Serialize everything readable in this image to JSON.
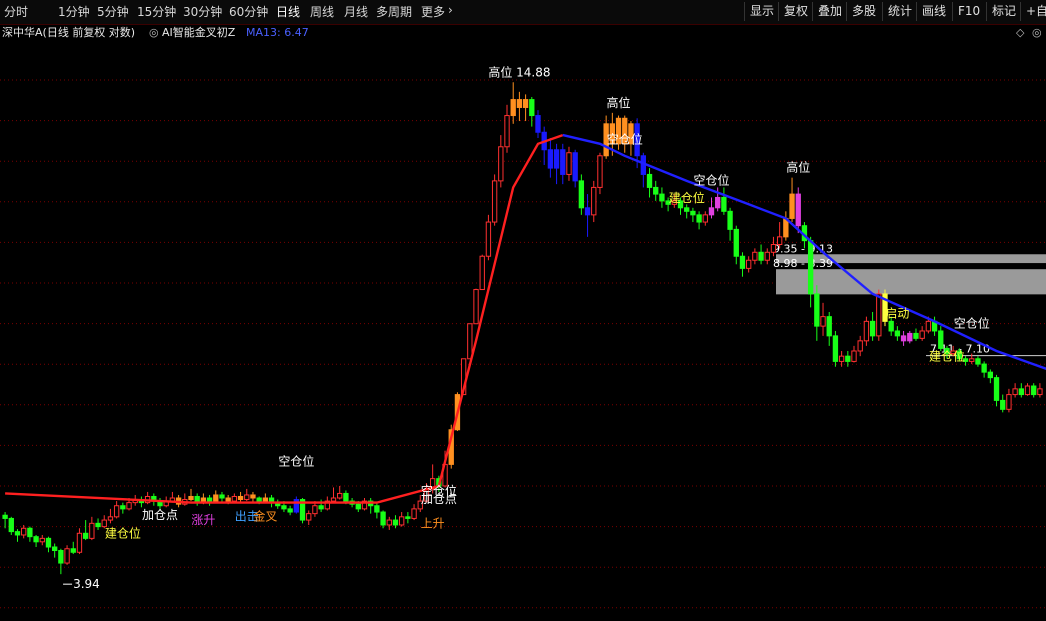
{
  "toolbar": {
    "timeframes": [
      "分时",
      "1分钟",
      "5分钟",
      "15分钟",
      "30分钟",
      "60分钟",
      "日线",
      "周线",
      "月线",
      "多周期",
      "更多"
    ],
    "active": "日线",
    "right_buttons": [
      "显示",
      "复权",
      "叠加",
      "多股",
      "统计",
      "画线",
      "F10",
      "标记",
      "+自选"
    ]
  },
  "info": {
    "stock_desc": "深中华A(日线 前复权 对数)",
    "indicator": "AI智能金叉初Z",
    "ma": "MA13: 6.47"
  },
  "colors": {
    "up": "#ff3030",
    "down": "#18ff18",
    "hot": "#ff9020",
    "cool": "#1a1aff",
    "magenta": "#e040e0",
    "yellow": "#ffff40",
    "ma_red": "#ff2020",
    "ma_blue": "#2020ff",
    "grid": "#7a0000"
  },
  "chart_data": {
    "type": "candlestick",
    "y_range": [
      3.5,
      16.5
    ],
    "candles": [
      [
        4.62,
        4.58,
        4.66,
        4.46
      ],
      [
        4.58,
        4.42,
        4.6,
        4.38
      ],
      [
        4.42,
        4.38,
        4.45,
        4.3
      ],
      [
        4.38,
        4.46,
        4.5,
        4.34
      ],
      [
        4.46,
        4.36,
        4.48,
        4.3
      ],
      [
        4.36,
        4.3,
        4.38,
        4.24
      ],
      [
        4.3,
        4.34,
        4.38,
        4.26
      ],
      [
        4.34,
        4.24,
        4.36,
        4.18
      ],
      [
        4.24,
        4.2,
        4.28,
        4.12
      ],
      [
        4.2,
        4.06,
        4.22,
        3.94
      ],
      [
        4.06,
        4.22,
        4.26,
        4.04
      ],
      [
        4.22,
        4.18,
        4.3,
        4.16
      ],
      [
        4.18,
        4.4,
        4.46,
        4.16
      ],
      [
        4.4,
        4.34,
        4.56,
        4.32
      ],
      [
        4.34,
        4.52,
        4.6,
        4.32
      ],
      [
        4.52,
        4.48,
        4.58,
        4.44
      ],
      [
        4.48,
        4.56,
        4.62,
        4.46
      ],
      [
        4.56,
        4.6,
        4.7,
        4.52
      ],
      [
        4.6,
        4.74,
        4.8,
        4.58
      ],
      [
        4.74,
        4.7,
        4.78,
        4.64
      ],
      [
        4.7,
        4.78,
        4.84,
        4.68
      ],
      [
        4.78,
        4.82,
        4.88,
        4.74
      ],
      [
        4.82,
        4.78,
        4.86,
        4.72
      ],
      [
        4.78,
        4.86,
        4.92,
        4.76
      ],
      [
        4.86,
        4.8,
        4.9,
        4.74
      ],
      [
        4.8,
        4.74,
        4.84,
        4.7
      ],
      [
        4.74,
        4.8,
        4.86,
        4.72
      ],
      [
        4.8,
        4.84,
        4.92,
        4.78
      ],
      [
        4.84,
        4.76,
        4.88,
        4.72
      ],
      [
        4.76,
        4.82,
        4.9,
        4.74
      ],
      [
        4.82,
        4.86,
        4.96,
        4.8
      ],
      [
        4.86,
        4.78,
        4.9,
        4.74
      ],
      [
        4.78,
        4.84,
        4.9,
        4.76
      ],
      [
        4.84,
        4.8,
        4.88,
        4.74
      ],
      [
        4.8,
        4.88,
        4.94,
        4.78
      ],
      [
        4.88,
        4.84,
        4.92,
        4.78
      ],
      [
        4.84,
        4.8,
        4.88,
        4.76
      ],
      [
        4.8,
        4.86,
        4.9,
        4.78
      ],
      [
        4.86,
        4.82,
        4.92,
        4.78
      ],
      [
        4.82,
        4.88,
        4.96,
        4.8
      ],
      [
        4.88,
        4.84,
        4.92,
        4.78
      ],
      [
        4.84,
        4.8,
        4.86,
        4.76
      ],
      [
        4.8,
        4.84,
        4.9,
        4.78
      ],
      [
        4.84,
        4.78,
        4.88,
        4.72
      ],
      [
        4.78,
        4.74,
        4.82,
        4.7
      ],
      [
        4.74,
        4.7,
        4.8,
        4.66
      ],
      [
        4.7,
        4.66,
        4.74,
        4.62
      ],
      [
        4.66,
        4.82,
        4.86,
        4.64
      ],
      [
        4.82,
        4.56,
        4.84,
        4.52
      ],
      [
        4.56,
        4.64,
        4.68,
        4.5
      ],
      [
        4.64,
        4.74,
        4.8,
        4.6
      ],
      [
        4.74,
        4.7,
        4.82,
        4.66
      ],
      [
        4.7,
        4.8,
        4.86,
        4.68
      ],
      [
        4.8,
        4.84,
        4.98,
        4.78
      ],
      [
        4.84,
        4.9,
        5.0,
        4.82
      ],
      [
        4.9,
        4.8,
        4.94,
        4.76
      ],
      [
        4.8,
        4.76,
        4.84,
        4.72
      ],
      [
        4.76,
        4.7,
        4.8,
        4.66
      ],
      [
        4.7,
        4.8,
        4.84,
        4.68
      ],
      [
        4.8,
        4.74,
        4.84,
        4.64
      ],
      [
        4.74,
        4.66,
        4.78,
        4.58
      ],
      [
        4.66,
        4.5,
        4.68,
        4.46
      ],
      [
        4.5,
        4.56,
        4.6,
        4.44
      ],
      [
        4.56,
        4.5,
        4.62,
        4.46
      ],
      [
        4.5,
        4.6,
        4.66,
        4.48
      ],
      [
        4.6,
        4.58,
        4.66,
        4.52
      ],
      [
        4.58,
        4.7,
        4.76,
        4.56
      ],
      [
        4.7,
        4.8,
        4.88,
        4.66
      ],
      [
        4.8,
        4.96,
        5.04,
        4.78
      ],
      [
        4.96,
        5.1,
        5.3,
        4.9
      ],
      [
        5.1,
        5.0,
        5.14,
        4.92
      ],
      [
        5.0,
        5.3,
        5.5,
        4.98
      ],
      [
        5.3,
        5.82,
        5.9,
        5.24
      ],
      [
        5.82,
        6.4,
        6.44,
        5.8
      ],
      [
        6.4,
        7.05,
        7.05,
        6.4
      ],
      [
        7.05,
        7.75,
        7.75,
        7.05
      ],
      [
        7.75,
        8.5,
        8.52,
        7.75
      ],
      [
        8.5,
        9.3,
        9.34,
        8.5
      ],
      [
        9.3,
        10.2,
        10.4,
        9.2
      ],
      [
        10.2,
        11.4,
        11.6,
        10.1
      ],
      [
        11.4,
        12.5,
        12.9,
        11.2
      ],
      [
        12.5,
        13.6,
        14.0,
        12.3
      ],
      [
        13.6,
        14.2,
        14.88,
        13.3
      ],
      [
        14.2,
        13.9,
        14.5,
        13.4
      ],
      [
        13.9,
        14.2,
        14.4,
        13.4
      ],
      [
        14.2,
        13.6,
        14.3,
        13.2
      ],
      [
        13.6,
        13.0,
        13.8,
        12.8
      ],
      [
        13.0,
        12.4,
        13.2,
        11.9
      ],
      [
        12.4,
        11.8,
        12.8,
        11.5
      ],
      [
        11.8,
        12.4,
        12.6,
        11.3
      ],
      [
        12.4,
        11.6,
        12.6,
        11.3
      ],
      [
        11.6,
        12.3,
        12.5,
        11.4
      ],
      [
        12.3,
        11.4,
        12.4,
        11.2
      ],
      [
        11.4,
        10.6,
        11.6,
        10.4
      ],
      [
        10.6,
        10.4,
        11.0,
        9.8
      ],
      [
        10.4,
        11.2,
        11.4,
        10.2
      ],
      [
        11.2,
        12.2,
        12.3,
        11.0
      ],
      [
        12.2,
        13.3,
        13.6,
        12.1
      ],
      [
        13.3,
        12.6,
        13.7,
        12.2
      ],
      [
        12.6,
        13.5,
        13.6,
        12.4
      ],
      [
        13.5,
        12.6,
        13.6,
        12.3
      ],
      [
        12.6,
        13.3,
        13.4,
        12.2
      ],
      [
        13.3,
        12.2,
        13.5,
        11.8
      ],
      [
        12.2,
        11.6,
        12.3,
        11.2
      ],
      [
        11.6,
        11.2,
        11.8,
        10.9
      ],
      [
        11.2,
        11.0,
        11.4,
        10.8
      ],
      [
        11.0,
        10.8,
        11.2,
        10.6
      ],
      [
        10.8,
        10.7,
        10.9,
        10.5
      ],
      [
        10.7,
        10.8,
        11.0,
        10.6
      ],
      [
        10.8,
        10.6,
        10.9,
        10.4
      ],
      [
        10.6,
        10.5,
        10.7,
        10.3
      ],
      [
        10.5,
        10.4,
        10.6,
        10.2
      ],
      [
        10.4,
        10.2,
        10.5,
        10.0
      ],
      [
        10.2,
        10.4,
        10.5,
        10.1
      ],
      [
        10.4,
        10.6,
        10.9,
        10.3
      ],
      [
        10.6,
        10.9,
        11.2,
        10.5
      ],
      [
        10.9,
        10.5,
        11.2,
        10.4
      ],
      [
        10.5,
        10.0,
        10.6,
        9.7
      ],
      [
        10.0,
        9.3,
        10.1,
        9.1
      ],
      [
        9.3,
        9.0,
        9.4,
        8.8
      ],
      [
        9.0,
        9.2,
        9.3,
        8.9
      ],
      [
        9.2,
        9.4,
        9.5,
        9.1
      ],
      [
        9.4,
        9.2,
        9.6,
        9.1
      ],
      [
        9.2,
        9.4,
        9.5,
        9.1
      ],
      [
        9.4,
        9.6,
        9.8,
        9.3
      ],
      [
        9.6,
        9.8,
        10.2,
        9.5
      ],
      [
        9.8,
        10.3,
        10.5,
        9.7
      ],
      [
        10.3,
        11.0,
        11.5,
        10.2
      ],
      [
        11.0,
        10.1,
        11.2,
        9.9
      ],
      [
        10.1,
        9.7,
        10.2,
        9.5
      ],
      [
        9.7,
        8.4,
        9.8,
        8.1
      ],
      [
        8.4,
        7.7,
        8.6,
        7.4
      ],
      [
        7.7,
        7.9,
        8.2,
        7.5
      ],
      [
        7.9,
        7.5,
        8.0,
        7.3
      ],
      [
        7.5,
        7.0,
        7.6,
        6.9
      ],
      [
        7.0,
        7.1,
        7.2,
        6.9
      ],
      [
        7.1,
        7.0,
        7.2,
        6.9
      ],
      [
        7.0,
        7.2,
        7.3,
        6.98
      ],
      [
        7.2,
        7.4,
        7.5,
        7.1
      ],
      [
        7.4,
        7.8,
        7.9,
        7.3
      ],
      [
        7.8,
        7.5,
        8.0,
        7.4
      ],
      [
        7.5,
        8.4,
        8.5,
        7.4
      ],
      [
        8.4,
        7.8,
        8.5,
        7.7
      ],
      [
        7.8,
        7.6,
        7.9,
        7.5
      ],
      [
        7.6,
        7.5,
        7.7,
        7.4
      ],
      [
        7.5,
        7.4,
        7.6,
        7.3
      ],
      [
        7.4,
        7.55,
        7.6,
        7.35
      ],
      [
        7.55,
        7.45,
        7.65,
        7.4
      ],
      [
        7.45,
        7.6,
        7.7,
        7.4
      ],
      [
        7.6,
        7.8,
        7.9,
        7.55
      ],
      [
        7.8,
        7.6,
        7.9,
        7.5
      ],
      [
        7.6,
        7.25,
        7.7,
        7.2
      ],
      [
        7.25,
        7.15,
        7.3,
        7.05
      ],
      [
        7.15,
        7.2,
        7.3,
        7.1
      ],
      [
        7.2,
        7.05,
        7.25,
        7.0
      ],
      [
        7.05,
        7.0,
        7.1,
        6.92
      ],
      [
        7.0,
        7.05,
        7.15,
        6.95
      ],
      [
        7.05,
        6.95,
        7.1,
        6.9
      ],
      [
        6.95,
        6.8,
        7.0,
        6.7
      ],
      [
        6.8,
        6.7,
        6.85,
        6.6
      ],
      [
        6.7,
        6.3,
        6.75,
        6.2
      ],
      [
        6.3,
        6.15,
        6.4,
        6.1
      ],
      [
        6.15,
        6.4,
        6.5,
        6.1
      ],
      [
        6.4,
        6.5,
        6.6,
        6.35
      ],
      [
        6.5,
        6.4,
        6.6,
        6.35
      ],
      [
        6.4,
        6.55,
        6.6,
        6.38
      ],
      [
        6.55,
        6.4,
        6.6,
        6.35
      ],
      [
        6.4,
        6.5,
        6.6,
        6.35
      ]
    ],
    "highlight_candles": [
      {
        "i": 28,
        "color": "#ff9020"
      },
      {
        "i": 30,
        "color": "#ff9020"
      },
      {
        "i": 32,
        "color": "#ff9020"
      },
      {
        "i": 34,
        "color": "#ff9020"
      },
      {
        "i": 36,
        "color": "#ff9020"
      },
      {
        "i": 38,
        "color": "#ff9020"
      },
      {
        "i": 40,
        "color": "#ff9020"
      },
      {
        "i": 42,
        "color": "#ff9020"
      },
      {
        "i": 47,
        "color": "#1a1aff"
      },
      {
        "i": 72,
        "color": "#ff9020"
      },
      {
        "i": 73,
        "color": "#ff9020"
      },
      {
        "i": 82,
        "color": "#ff9020"
      },
      {
        "i": 83,
        "color": "#ff9020"
      },
      {
        "i": 84,
        "color": "#ff9020"
      },
      {
        "i": 86,
        "color": "#1a1aff"
      },
      {
        "i": 87,
        "color": "#1a1aff"
      },
      {
        "i": 88,
        "color": "#1a1aff"
      },
      {
        "i": 89,
        "color": "#1a1aff"
      },
      {
        "i": 90,
        "color": "#1a1aff"
      },
      {
        "i": 92,
        "color": "#1a1aff"
      },
      {
        "i": 94,
        "color": "#1a1aff"
      },
      {
        "i": 97,
        "color": "#ff9020"
      },
      {
        "i": 98,
        "color": "#ff9020"
      },
      {
        "i": 99,
        "color": "#ff9020"
      },
      {
        "i": 100,
        "color": "#ff9020"
      },
      {
        "i": 101,
        "color": "#ff9020"
      },
      {
        "i": 102,
        "color": "#1a1aff"
      },
      {
        "i": 103,
        "color": "#1a1aff"
      },
      {
        "i": 114,
        "color": "#e040e0"
      },
      {
        "i": 115,
        "color": "#e040e0"
      },
      {
        "i": 126,
        "color": "#ff9020"
      },
      {
        "i": 127,
        "color": "#ff9020"
      },
      {
        "i": 128,
        "color": "#e040e0"
      },
      {
        "i": 142,
        "color": "#ffff40"
      },
      {
        "i": 145,
        "color": "#e040e0"
      },
      {
        "i": 146,
        "color": "#e040e0"
      }
    ],
    "ma13": {
      "red_segment": [
        [
          0,
          4.9
        ],
        [
          30,
          4.78
        ],
        [
          60,
          4.78
        ],
        [
          70,
          5.0
        ],
        [
          76,
          7.4
        ],
        [
          82,
          11.2
        ],
        [
          86,
          12.6
        ],
        [
          90,
          12.9
        ]
      ],
      "blue_segment": [
        [
          90,
          12.9
        ],
        [
          96,
          12.6
        ],
        [
          100,
          12.2
        ],
        [
          110,
          11.4
        ],
        [
          120,
          10.7
        ],
        [
          126,
          10.3
        ],
        [
          132,
          9.4
        ],
        [
          140,
          8.4
        ],
        [
          150,
          7.8
        ],
        [
          160,
          7.2
        ],
        [
          172,
          6.7
        ]
      ]
    },
    "zones": [
      {
        "top": 9.35,
        "bottom": 9.13,
        "label": "9.35 - 9.13",
        "color": "#9a9a9a"
      },
      {
        "top": 8.98,
        "bottom": 8.39,
        "label": "8.98 - 8.39",
        "color": "#9a9a9a"
      }
    ],
    "level_line": {
      "value": 7.11,
      "label": "7.11 - 7.10"
    },
    "annotations": [
      {
        "text": "高位 14.88",
        "i": 83,
        "price": 14.88,
        "color": "#ffffff",
        "pos": "above"
      },
      {
        "text": "高位",
        "i": 99,
        "price": 13.7,
        "color": "#ffffff",
        "pos": "above"
      },
      {
        "text": "高位",
        "i": 128,
        "price": 11.5,
        "color": "#ffffff",
        "pos": "above"
      },
      {
        "text": "空仓位",
        "i": 100,
        "price": 12.4,
        "color": "#ffffff",
        "pos": "above"
      },
      {
        "text": "空仓位",
        "i": 114,
        "price": 11.1,
        "color": "#ffffff",
        "pos": "above"
      },
      {
        "text": "空仓位",
        "i": 156,
        "price": 7.55,
        "color": "#ffffff",
        "pos": "above"
      },
      {
        "text": "空仓位",
        "i": 47,
        "price": 5.2,
        "color": "#ffffff",
        "pos": "above"
      },
      {
        "text": "空仓位",
        "i": 70,
        "price": 4.8,
        "color": "#ffffff",
        "pos": "above"
      },
      {
        "text": "建仓位",
        "i": 110,
        "price": 10.6,
        "color": "#ffff40",
        "pos": "above"
      },
      {
        "text": "建仓位",
        "i": 152,
        "price": 6.9,
        "color": "#ffff40",
        "pos": "above"
      },
      {
        "text": "建仓位",
        "i": 19,
        "price": 4.28,
        "color": "#ffff40",
        "pos": "above"
      },
      {
        "text": "启动",
        "i": 144,
        "price": 7.75,
        "color": "#ffff40",
        "pos": "above"
      },
      {
        "text": "加仓点",
        "i": 25,
        "price": 4.5,
        "color": "#ffffff",
        "pos": "above"
      },
      {
        "text": "涨升",
        "i": 32,
        "price": 4.44,
        "color": "#e040e0",
        "pos": "above"
      },
      {
        "text": "出击",
        "i": 39,
        "price": 4.48,
        "color": "#40a0ff",
        "pos": "above"
      },
      {
        "text": "金叉",
        "i": 42,
        "price": 4.48,
        "color": "#ff9020",
        "pos": "above"
      },
      {
        "text": "加仓点",
        "i": 70,
        "price": 4.7,
        "color": "#ffffff",
        "pos": "above"
      },
      {
        "text": "上升",
        "i": 69,
        "price": 4.4,
        "color": "#ff9020",
        "pos": "above"
      },
      {
        "text": "3.94",
        "i": 10,
        "price": 3.94,
        "color": "#ffffff",
        "pos": "below"
      }
    ]
  }
}
